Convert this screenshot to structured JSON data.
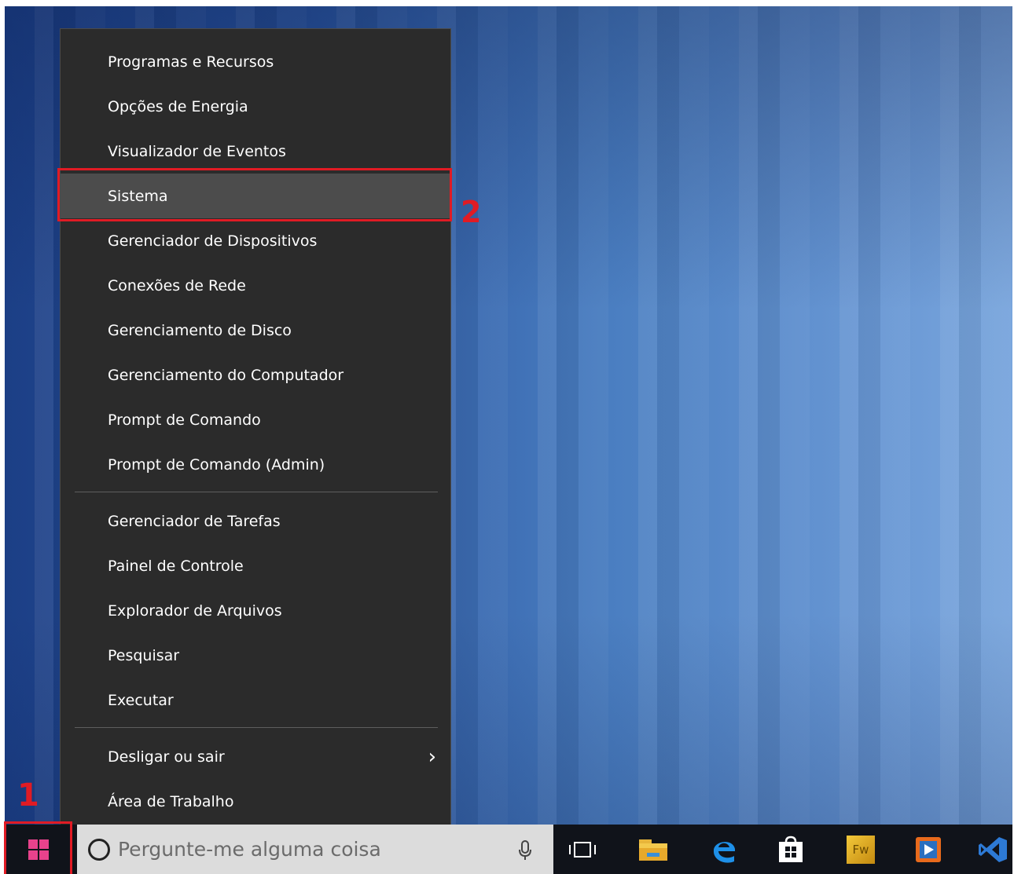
{
  "menu": {
    "items": [
      {
        "label": "Programas e Recursos"
      },
      {
        "label": "Opções de Energia"
      },
      {
        "label": "Visualizador de Eventos"
      },
      {
        "label": "Sistema"
      },
      {
        "label": "Gerenciador de Dispositivos"
      },
      {
        "label": "Conexões de Rede"
      },
      {
        "label": "Gerenciamento de Disco"
      },
      {
        "label": "Gerenciamento do Computador"
      },
      {
        "label": "Prompt de Comando"
      },
      {
        "label": "Prompt de Comando (Admin)"
      },
      {
        "label": "Gerenciador de Tarefas"
      },
      {
        "label": "Painel de Controle"
      },
      {
        "label": "Explorador de Arquivos"
      },
      {
        "label": "Pesquisar"
      },
      {
        "label": "Executar"
      },
      {
        "label": "Desligar ou sair"
      },
      {
        "label": "Área de Trabalho"
      }
    ],
    "selected_label": "Sistema",
    "submenu_arrow": "›"
  },
  "annotations": {
    "step1": "1",
    "step2": "2",
    "color": "#e01b24"
  },
  "taskbar": {
    "search_placeholder": "Pergunte-me alguma coisa",
    "icons": [
      "windows-start-icon",
      "cortana-icon",
      "microphone-icon",
      "task-view-icon",
      "file-explorer-icon",
      "edge-icon",
      "store-icon",
      "fireworks-icon",
      "media-player-icon",
      "visual-studio-icon"
    ],
    "fireworks_label": "Fw"
  }
}
